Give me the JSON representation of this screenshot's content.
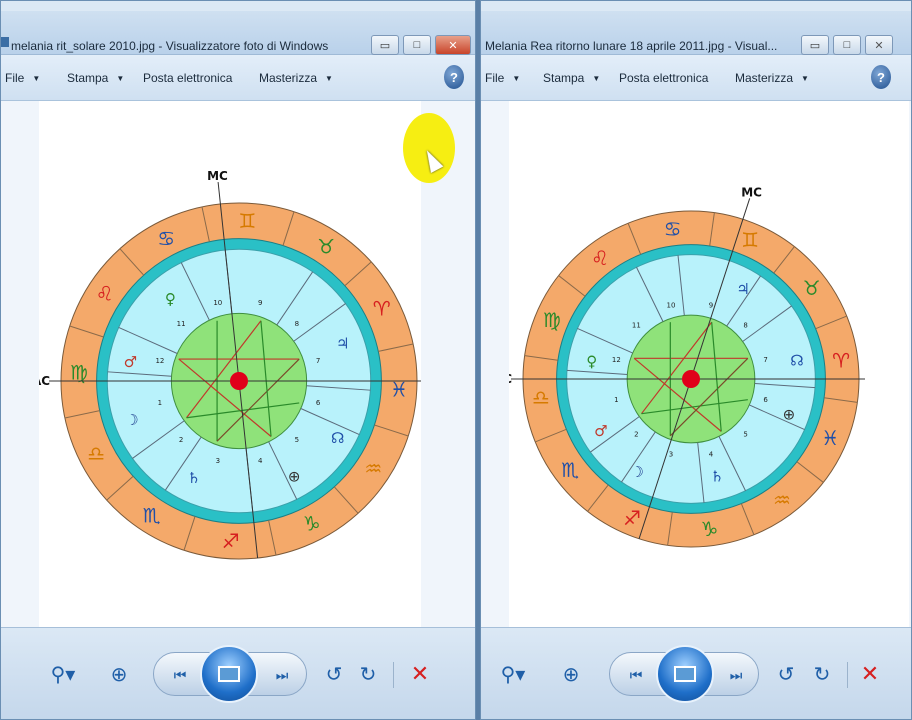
{
  "windows": [
    {
      "id": "left",
      "title": "melania rit_solare 2010.jpg - Visualizzatore foto di Windows",
      "menu": [
        {
          "label": "File",
          "has_dropdown": true
        },
        {
          "label": "Stampa",
          "has_dropdown": true
        },
        {
          "label": "Posta elettronica",
          "has_dropdown": false
        },
        {
          "label": "Masterizza",
          "has_dropdown": true
        }
      ],
      "help": "?",
      "chart": {
        "top_label": "MC",
        "left_label": "AC",
        "houses": [
          "1",
          "2",
          "3",
          "4",
          "5",
          "6",
          "7",
          "8",
          "9",
          "10",
          "11",
          "12"
        ]
      }
    },
    {
      "id": "right",
      "title": "Melania Rea ritorno lunare 18 aprile 2011.jpg - Visual...",
      "menu": [
        {
          "label": "File",
          "has_dropdown": true
        },
        {
          "label": "Stampa",
          "has_dropdown": true
        },
        {
          "label": "Posta elettronica",
          "has_dropdown": false
        },
        {
          "label": "Masterizza",
          "has_dropdown": true
        }
      ],
      "help": "?",
      "chart": {
        "top_label": "MC",
        "left_label": "AC",
        "houses": [
          "1",
          "2",
          "3",
          "4",
          "5",
          "6",
          "7",
          "8",
          "9",
          "10",
          "11",
          "12"
        ]
      }
    }
  ],
  "controls": {
    "zoom": "⚲▾",
    "fit": "⊕",
    "prev": "⏮",
    "next": "⏭",
    "rotate_ccw": "↺",
    "rotate_cw": "↻",
    "delete": "✕"
  },
  "window_buttons": {
    "minimize": "▭",
    "maximize": "□",
    "close": "✕"
  },
  "colors": {
    "zodiac_ring": "#f4a96a",
    "teal_ring": "#2ac0c6",
    "house_area": "#b8f2fb",
    "center": "#8fe27a",
    "center_dot": "#e0001a",
    "accent_blue": "#1f5fa8",
    "delete_red": "#d62020"
  }
}
